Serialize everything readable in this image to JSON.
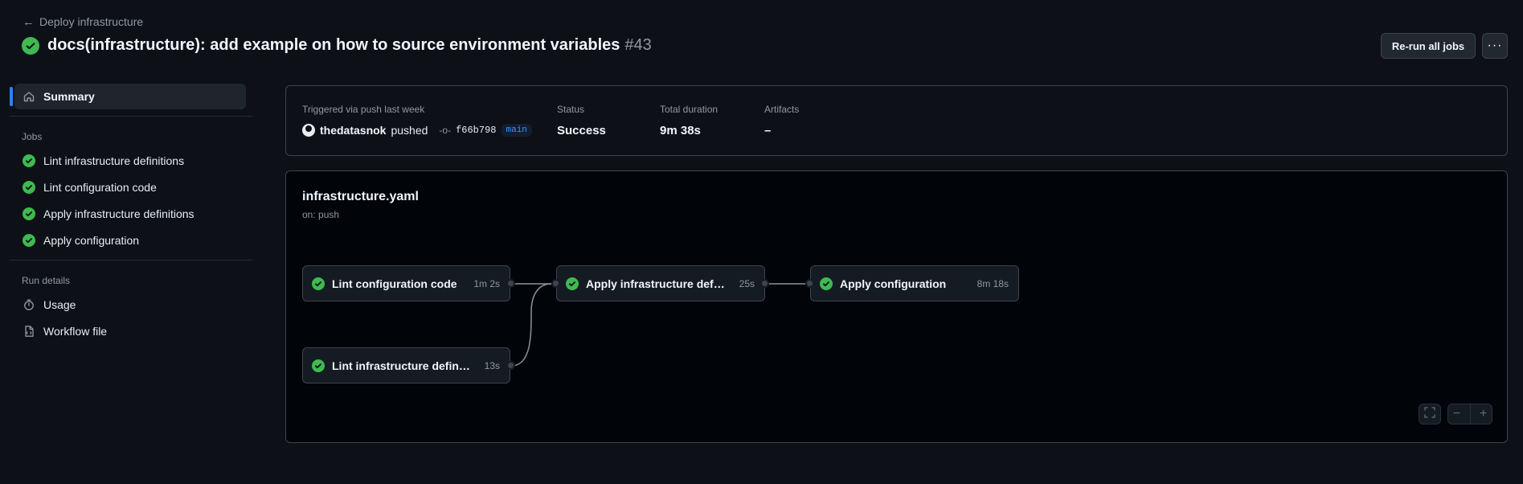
{
  "header": {
    "back_label": "Deploy infrastructure",
    "title": "docs(infrastructure): add example on how to source environment variables",
    "run_number": "#43",
    "rerun_label": "Re-run all jobs",
    "more_label": "···"
  },
  "sidebar": {
    "summary_label": "Summary",
    "jobs_heading": "Jobs",
    "jobs": [
      "Lint infrastructure definitions",
      "Lint configuration code",
      "Apply infrastructure definitions",
      "Apply configuration"
    ],
    "run_details_heading": "Run details",
    "usage_label": "Usage",
    "workflow_file_label": "Workflow file"
  },
  "summary": {
    "trigger_label": "Triggered via push last week",
    "actor": "thedatasnok",
    "action": "pushed",
    "commit_sha": "f66b798",
    "branch": "main",
    "status_label": "Status",
    "status_value": "Success",
    "duration_label": "Total duration",
    "duration_value": "9m 38s",
    "artifacts_label": "Artifacts",
    "artifacts_value": "–"
  },
  "graph": {
    "workflow_file": "infrastructure.yaml",
    "trigger": "on: push",
    "nodes": [
      {
        "name": "Lint configuration code",
        "duration": "1m 2s"
      },
      {
        "name": "Lint infrastructure definitions",
        "duration": "13s"
      },
      {
        "name": "Apply infrastructure definiti...",
        "duration": "25s"
      },
      {
        "name": "Apply configuration",
        "duration": "8m 18s"
      }
    ],
    "controls": {
      "fullscreen_icon": "fullscreen-icon",
      "zoom_out": "−",
      "zoom_in": "+"
    }
  },
  "colors": {
    "success": "#3fb950",
    "accent": "#2f81f7",
    "background": "#0d1117",
    "graph_background": "#010409"
  }
}
